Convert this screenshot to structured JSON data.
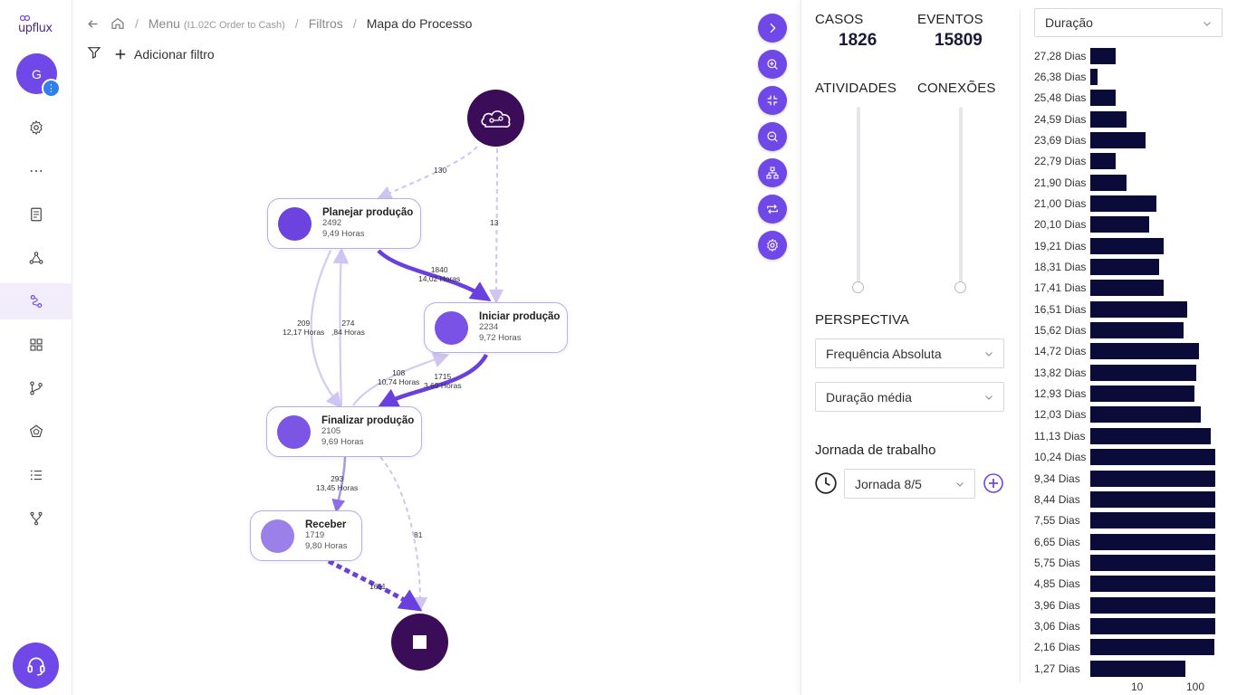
{
  "app": {
    "logo_text": "upflux"
  },
  "user": {
    "initial": "G",
    "badge": "⋮"
  },
  "breadcrumb": {
    "menu": "Menu",
    "menu_detail": "(I1.02C Order to Cash)",
    "filters": "Filtros",
    "current": "Mapa do Processo"
  },
  "filter_bar": {
    "add_label": "Adicionar filtro"
  },
  "process_map": {
    "nodes": [
      {
        "id": "planejar",
        "title": "Planejar produção",
        "count": "2492",
        "duration": "9,49 Horas",
        "color": "#6d43e0"
      },
      {
        "id": "iniciar",
        "title": "Iniciar produção",
        "count": "2234",
        "duration": "9,72 Horas",
        "color": "#7a52e6"
      },
      {
        "id": "finalizar",
        "title": "Finalizar produção",
        "count": "2105",
        "duration": "9,69 Horas",
        "color": "#7b55e4"
      },
      {
        "id": "receber",
        "title": "Receber",
        "count": "1719",
        "duration": "9,80 Horas",
        "color": "#9a80e8"
      }
    ],
    "edges": [
      {
        "id": "start-planejar",
        "label": "130",
        "sub": ""
      },
      {
        "id": "start-iniciar",
        "label": "13",
        "sub": ""
      },
      {
        "id": "planejar-iniciar",
        "label": "1840",
        "sub": "14,02 Horas"
      },
      {
        "id": "planejar-finalizar",
        "label": "209",
        "sub": "12,17 Horas"
      },
      {
        "id": "finalizar-planejar",
        "label": "274",
        "sub": ",84 Horas"
      },
      {
        "id": "finalizar-iniciar",
        "label": "108",
        "sub": "10,74 Horas"
      },
      {
        "id": "iniciar-finalizar",
        "label": "1715",
        "sub": "3,69 Horas"
      },
      {
        "id": "finalizar-receber",
        "label": "293",
        "sub": "13,45 Horas"
      },
      {
        "id": "finalizar-end",
        "label": "81",
        "sub": ""
      },
      {
        "id": "receber-end",
        "label": "1611",
        "sub": ""
      }
    ]
  },
  "panel": {
    "casos_label": "CASOS",
    "casos_value": "1826",
    "eventos_label": "EVENTOS",
    "eventos_value": "15809",
    "atividades_label": "ATIVIDADES",
    "conexoes_label": "CONEXÕES",
    "perspectiva_label": "PERSPECTIVA",
    "perspectiva_select": "Frequência Absoluta",
    "metric_select": "Duração média",
    "jornada_label": "Jornada de trabalho",
    "jornada_select": "Jornada 8/5"
  },
  "histogram": {
    "select": "Duração",
    "axis_ticks": [
      "10",
      "100"
    ],
    "rows": [
      {
        "label": "27,28 Dias",
        "value": 2
      },
      {
        "label": "26,38 Dias",
        "value": 1
      },
      {
        "label": "25,48 Dias",
        "value": 2
      },
      {
        "label": "24,59 Dias",
        "value": 3
      },
      {
        "label": "23,69 Dias",
        "value": 6
      },
      {
        "label": "22,79 Dias",
        "value": 2
      },
      {
        "label": "21,90 Dias",
        "value": 3
      },
      {
        "label": "21,00 Dias",
        "value": 9
      },
      {
        "label": "20,10 Dias",
        "value": 7
      },
      {
        "label": "19,21 Dias",
        "value": 12
      },
      {
        "label": "18,31 Dias",
        "value": 10
      },
      {
        "label": "17,41 Dias",
        "value": 12
      },
      {
        "label": "16,51 Dias",
        "value": 29
      },
      {
        "label": "15,62 Dias",
        "value": 25
      },
      {
        "label": "14,72 Dias",
        "value": 45
      },
      {
        "label": "13,82 Dias",
        "value": 40
      },
      {
        "label": "12,93 Dias",
        "value": 38
      },
      {
        "label": "12,03 Dias",
        "value": 48
      },
      {
        "label": "11,13 Dias",
        "value": 70
      },
      {
        "label": "10,24 Dias",
        "value": 100
      },
      {
        "label": "9,34 Dias",
        "value": 82
      },
      {
        "label": "8,44 Dias",
        "value": 110
      },
      {
        "label": "7,55 Dias",
        "value": 105
      },
      {
        "label": "6,65 Dias",
        "value": 112
      },
      {
        "label": "5,75 Dias",
        "value": 160
      },
      {
        "label": "4,85 Dias",
        "value": 108
      },
      {
        "label": "3,96 Dias",
        "value": 118
      },
      {
        "label": "3,06 Dias",
        "value": 90
      },
      {
        "label": "2,16 Dias",
        "value": 80
      },
      {
        "label": "1,27 Dias",
        "value": 27
      }
    ]
  },
  "colors": {
    "accent": "#7048e8",
    "endpoint": "#3b0c57",
    "hist_bar": "#0b0b3a"
  }
}
